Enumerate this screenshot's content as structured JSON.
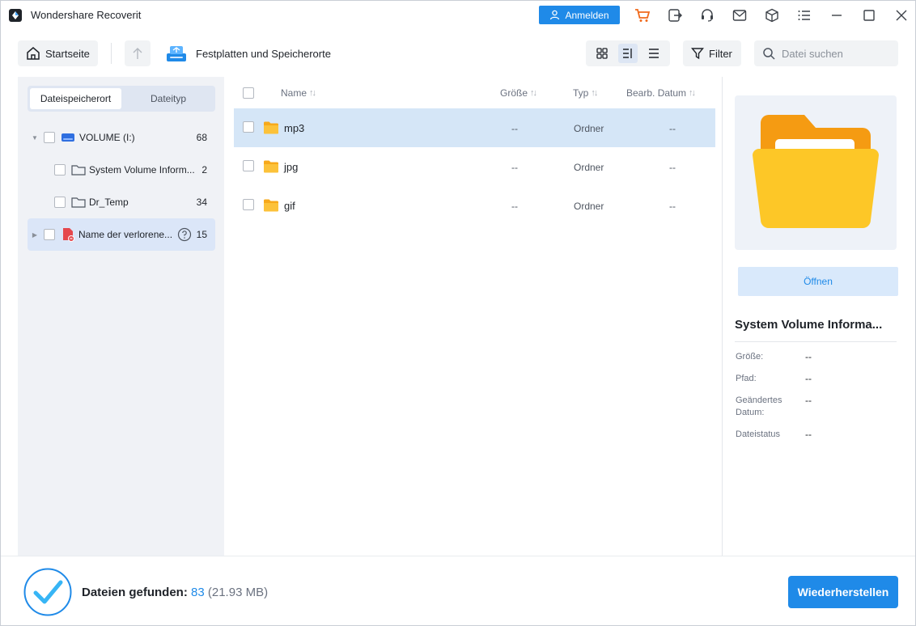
{
  "app": {
    "title": "Wondershare Recoverit",
    "login_label": "Anmelden"
  },
  "titlebar_icons": [
    "cart-icon",
    "export-icon",
    "support-icon",
    "mail-icon",
    "box-icon",
    "menu-icon",
    "minimize-icon",
    "maximize-icon",
    "close-icon"
  ],
  "toolbar": {
    "home_label": "Startseite",
    "breadcrumb": "Festplatten und Speicherorte",
    "filter_label": "Filter",
    "search_placeholder": "Datei suchen"
  },
  "left_tabs": [
    {
      "label": "Dateispeicherort",
      "active": true
    },
    {
      "label": "Dateityp",
      "active": false
    }
  ],
  "tree": [
    {
      "label": "VOLUME (I:)",
      "count": "68"
    },
    {
      "label": "System Volume Inform...",
      "count": "2"
    },
    {
      "label": "Dr_Temp",
      "count": "34"
    },
    {
      "label": "Name der verlorene...",
      "count": "15"
    }
  ],
  "list": {
    "headers": {
      "name": "Name",
      "size": "Größe",
      "type": "Typ",
      "date": "Bearb. Datum"
    },
    "rows": [
      {
        "name": "mp3",
        "size": "--",
        "type": "Ordner",
        "date": "--"
      },
      {
        "name": "jpg",
        "size": "--",
        "type": "Ordner",
        "date": "--"
      },
      {
        "name": "gif",
        "size": "--",
        "type": "Ordner",
        "date": "--"
      }
    ]
  },
  "details": {
    "open_label": "Öffnen",
    "title": "System Volume Informa...",
    "fields": [
      {
        "label": "Größe:",
        "value": "--"
      },
      {
        "label": "Pfad:",
        "value": "--"
      },
      {
        "label": "Geändertes Datum:",
        "value": "--"
      },
      {
        "label": "Dateistatus",
        "value": "--"
      }
    ]
  },
  "status": {
    "found_label": "Dateien gefunden:",
    "found_count": "83",
    "found_size": "(21.93 MB)",
    "recover_label": "Wiederherstellen"
  },
  "colors": {
    "accent": "#1f8ae8",
    "folder": "#fbb81c",
    "selection": "#d5e6f7"
  }
}
